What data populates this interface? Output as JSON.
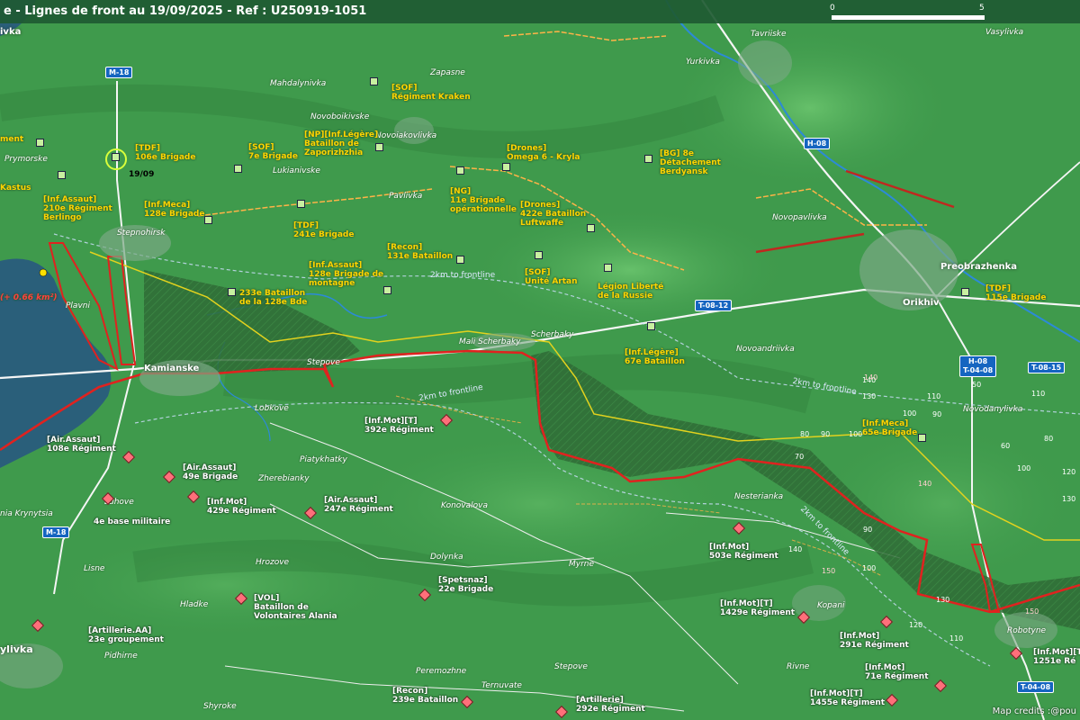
{
  "title": "e - Lignes de front au 19/09/2025 - Ref : U250919-1051",
  "scale": {
    "zero": "0",
    "five": "5"
  },
  "credits": "Map credits :@pou",
  "roads": {
    "m18_top": "M-18",
    "m18_bottom": "M-18",
    "h08_top": "H-08",
    "t0812": "T-08-12",
    "h08_t0408_a": "H-08",
    "h08_t0408_b": "T-04-08",
    "t0815": "T-08-15",
    "t0408_bottom": "T-04-08"
  },
  "cities": {
    "orikhiv": "Orikhiv",
    "kamianske": "Kamianske",
    "preobrazhenka": "Preobrazhenka"
  },
  "places": [
    "Tavriiske",
    "Vasylivka",
    "Yurkivka",
    "Zapasne",
    "Mahdalynivka",
    "Novoboikivske",
    "Novoiakovlivka",
    "Prymorske",
    "Lukianivske",
    "Pavlivka",
    "Novopavlivka",
    "Stepnohirsk",
    "Plavni",
    "Mali Scherbaky",
    "Scherbaky",
    "Stepove",
    "Novoandriivka",
    "Lobkove",
    "Piatykhatky",
    "Zherebianky",
    "Luhove",
    "nia Krynytsia",
    "Konovalova",
    "Nesterianka",
    "Novodanylivka",
    "Hrozove",
    "Dolynka",
    "Myrne",
    "Lisne",
    "Hladke",
    "Pidhirne",
    "ylivka",
    "Peremozhne",
    "Ternuvate",
    "Stepove",
    "Rivne",
    "Kopani",
    "Robotyne",
    "Shyroke",
    "ivka"
  ],
  "frontline_labels": [
    "2km to frontline",
    "2km to frontline",
    "2km to frontline",
    "2km to frontline"
  ],
  "elevations": [
    "140",
    "130",
    "110",
    "100",
    "90",
    "90",
    "80",
    "70",
    "100",
    "140",
    "90",
    "100",
    "130",
    "140",
    "150",
    "150",
    "120",
    "110",
    "60",
    "50",
    "110",
    "140",
    "80",
    "100",
    "120",
    "130"
  ],
  "ua_units": [
    "[SOF]\nRégiment Kraken",
    "[NP][Inf.Légère]\nBataillon de\nZaporizhzhia",
    "[TDF]\n106e Brigade",
    "[SOF]\n7e Brigade",
    "[Drones]\nOmega 6 - Kryla",
    "[BG] 8e\nDétachement\nBerdyansk",
    "[NG]\n11e Brigade\nopérationnelle",
    "[Drones]\n422e Bataillon\nLuftwaffe",
    "[Inf.Assaut]\n210e Régiment\nBerlingo",
    "[Inf.Meca]\n128e Brigade",
    "[TDF]\n241e Brigade",
    "[Recon]\n131e Bataillon",
    "[Inf.Assaut]\n128e Brigade de\nmontagne",
    "233e Bataillon\nde la 128e Bde",
    "[SOF]\nUnité Artan",
    "Légion Liberté\nde la Russie",
    "[TDF]\n115e Brigade",
    "[Inf.Légère]\n67e Bataillon",
    "[Inf.Meca]\n65e Brigade",
    "ment",
    "Kastus",
    "(+ 0.66 km²)"
  ],
  "ru_units": [
    "[Inf.Mot][T]\n392e Régiment",
    "[Air.Assaut]\n108e Régiment",
    "[Air.Assaut]\n49e Brigade",
    "[Inf.Mot]\n429e Régiment",
    "[Air.Assaut]\n247e Régiment",
    "4e base militaire",
    "[Inf.Mot]\n503e Régiment",
    "[VOL]\nBataillon de\nVolontaires Alania",
    "[Spetsnaz]\n22e Brigade",
    "[Inf.Mot][T]\n1429e Régiment",
    "[Inf.Mot]\n291e Régiment",
    "[Artillerie.AA]\n23e groupement",
    "[Inf.Mot]\n71e Régiment",
    "[Inf.Mot][T]\n1455e Régiment",
    "[Inf.Mot][T]\n1251e Ré",
    "[Recon]\n239e Bataillon",
    "[Artillerie]\n292e Régiment"
  ],
  "tdf_date": "19/09",
  "colors": {
    "ua_text": "#ffd400",
    "ru_marker": "#ff6f7a",
    "front": "#e0221f",
    "water": "#2a6f8a"
  }
}
